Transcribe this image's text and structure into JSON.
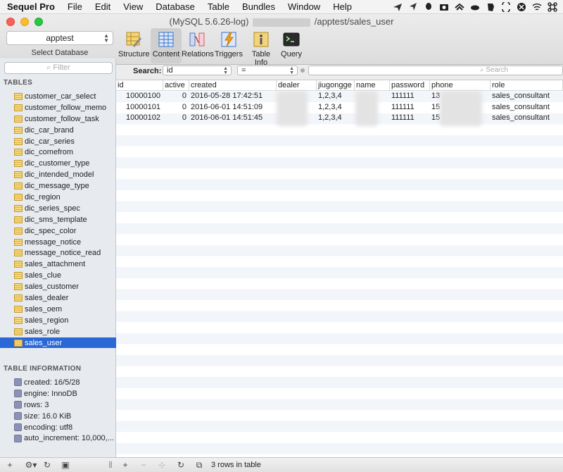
{
  "menubar": {
    "items": [
      "Sequel Pro",
      "File",
      "Edit",
      "View",
      "Database",
      "Table",
      "Bundles",
      "Window",
      "Help"
    ]
  },
  "window": {
    "title_prefix": "(MySQL 5.6.26-log)",
    "title_suffix": "/apptest/sales_user"
  },
  "toolbar": {
    "database_value": "apptest",
    "database_caption": "Select Database",
    "buttons": [
      {
        "label": "Structure",
        "icon": "structure-icon"
      },
      {
        "label": "Content",
        "icon": "content-icon"
      },
      {
        "label": "Relations",
        "icon": "relations-icon"
      },
      {
        "label": "Triggers",
        "icon": "triggers-icon"
      },
      {
        "label": "Table Info",
        "icon": "table-info-icon"
      },
      {
        "label": "Query",
        "icon": "query-icon"
      }
    ],
    "active": "Content"
  },
  "sidebar": {
    "filter_placeholder": "Filter",
    "tables_heading": "TABLES",
    "tables": [
      "customer_car_select",
      "customer_follow_memo",
      "customer_follow_task",
      "dic_car_brand",
      "dic_car_series",
      "dic_comefrom",
      "dic_customer_type",
      "dic_intended_model",
      "dic_message_type",
      "dic_region",
      "dic_series_spec",
      "dic_sms_template",
      "dic_spec_color",
      "message_notice",
      "message_notice_read",
      "sales_attachment",
      "sales_clue",
      "sales_customer",
      "sales_dealer",
      "sales_oem",
      "sales_region",
      "sales_role",
      "sales_user"
    ],
    "selected_table": "sales_user",
    "info_heading": "TABLE INFORMATION",
    "info": [
      "created: 16/5/28",
      "engine: InnoDB",
      "rows: 3",
      "size: 16.0 KiB",
      "encoding: utf8",
      "auto_increment: 10,000,..."
    ]
  },
  "search": {
    "label": "Search:",
    "field": "id",
    "operator": "=",
    "placeholder": "Search"
  },
  "grid": {
    "columns": [
      "id",
      "active",
      "created",
      "dealer",
      "jiugongge",
      "name",
      "password",
      "phone",
      "role"
    ],
    "rows": [
      [
        "10000100",
        "0",
        "2016-05-28 17:42:51",
        "",
        "1,2,3,4",
        "",
        "111111",
        "13",
        "sales_consultant"
      ],
      [
        "10000101",
        "0",
        "2016-06-01 14:51:09",
        "",
        "1,2,3,4",
        "",
        "111111",
        "15",
        "sales_consultant"
      ],
      [
        "10000102",
        "0",
        "2016-06-01 14:51:45",
        "",
        "1,2,3,4",
        "",
        "111111",
        "15",
        "sales_consultant"
      ]
    ]
  },
  "bottom": {
    "status": "3 rows in table"
  }
}
